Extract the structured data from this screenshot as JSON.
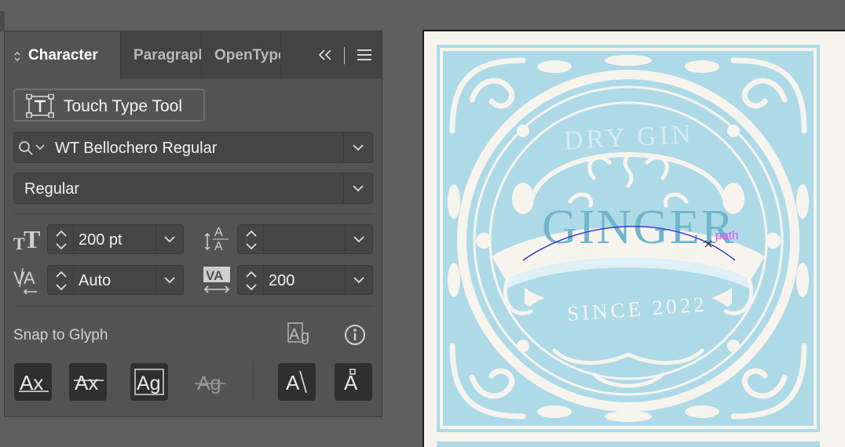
{
  "panel": {
    "tabs": [
      {
        "label": "Character",
        "active": true
      },
      {
        "label": "Paragraph",
        "active": false
      },
      {
        "label": "OpenType",
        "active": false
      }
    ],
    "controls": {
      "collapse_icon": "double-chevron-left-icon",
      "menu_icon": "hamburger-menu-icon"
    },
    "touch_type_label": "Touch Type Tool",
    "font_family": "WT Bellochero Regular",
    "font_style": "Regular",
    "font_size": "200 pt",
    "leading": "",
    "kerning": "Auto",
    "tracking": "200",
    "snap_to_glyph_label": "Snap to Glyph"
  },
  "artwork": {
    "top_text": "DRY GIN",
    "main_text": "GINGER",
    "bottom_text": "SINCE 2022",
    "path_label": "path",
    "colors": {
      "label_fill": "#aedae8",
      "ornament": "#f7f4ee",
      "text": "#6fb6cc",
      "path": "#3c3ccf",
      "path_label": "#e34ce6"
    }
  }
}
